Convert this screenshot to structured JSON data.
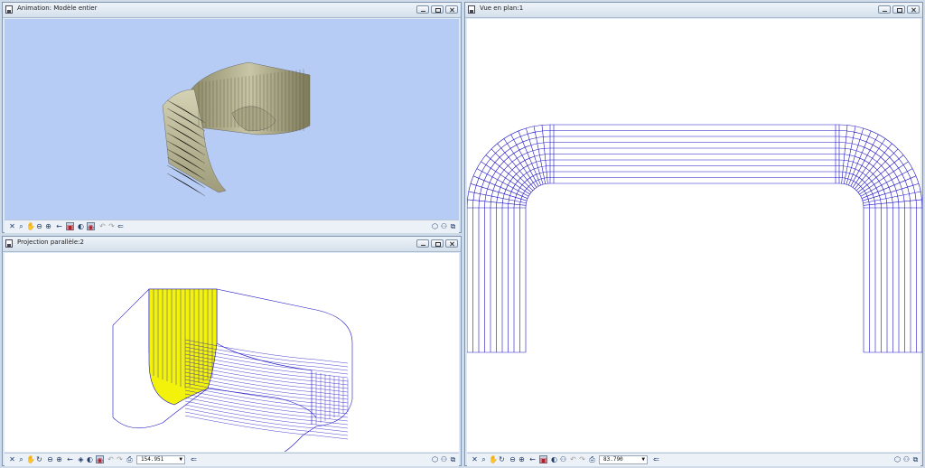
{
  "windows": {
    "animation": {
      "title": "Animation: Modèle entier",
      "bg": "#b7ccf5",
      "surface": "#b5b291"
    },
    "projection": {
      "title": "Projection parallèle:2",
      "zoom": "154.951",
      "highlight": "#f2f20a",
      "line": "#1c12c4"
    },
    "plan": {
      "title": "Vue en plan:1",
      "zoom": "83.790",
      "line": "#1c12c4"
    }
  },
  "icons": {
    "window_buttons": [
      "minimize-icon",
      "restore-icon",
      "close-icon"
    ],
    "view_tools": [
      "close-view-icon",
      "zoom-icon",
      "pan-icon",
      "zoom-in-icon",
      "zoom-out-icon",
      "rotate-icon",
      "previous-icon",
      "render-icon",
      "display-icon",
      "undo-icon",
      "redo-icon",
      "navigate-icon"
    ]
  }
}
